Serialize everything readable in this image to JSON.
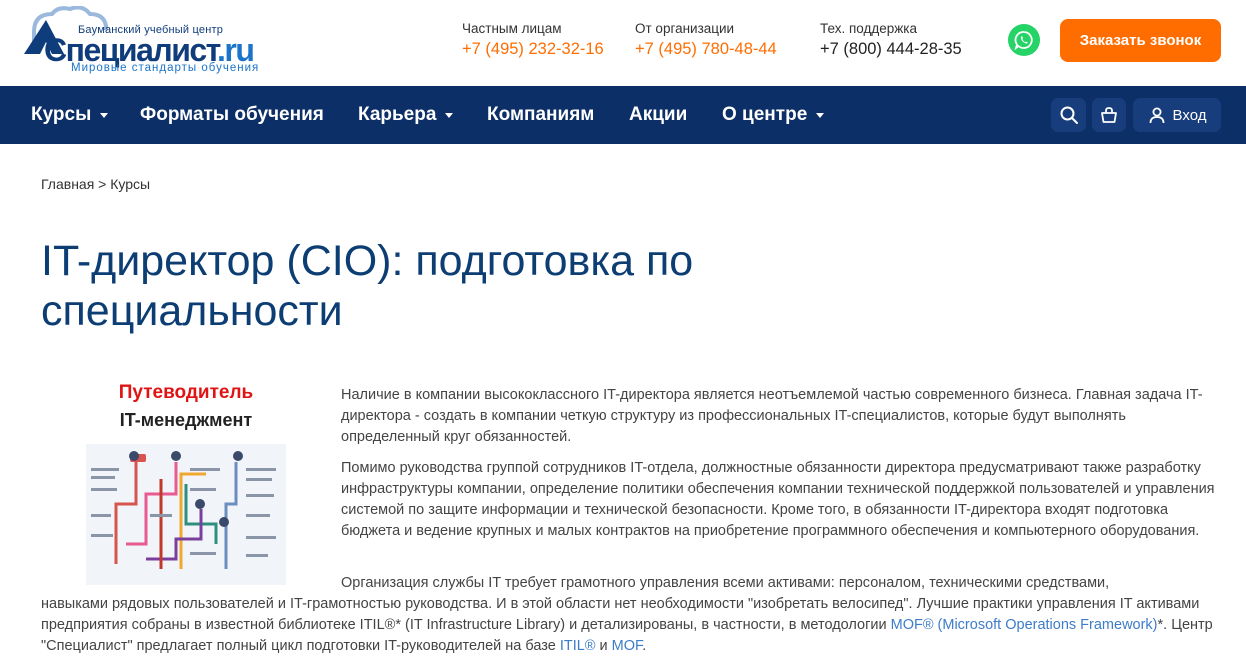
{
  "header": {
    "logo": {
      "tagline_top": "Бауманский учебный центр",
      "brand": "Специалист",
      "brand_suffix": ".ru",
      "motto": "Мировые стандарты обучения"
    },
    "contacts": [
      {
        "label": "Частным лицам",
        "phone": "+7 (495) 232-32-16"
      },
      {
        "label": "От организации",
        "phone": "+7 (495) 780-48-44"
      },
      {
        "label": "Тех. поддержка",
        "phone": "+7 (800) 444-28-35"
      }
    ],
    "callback_label": "Заказать звонок"
  },
  "nav": {
    "items": [
      {
        "label": "Курсы"
      },
      {
        "label": "Форматы обучения"
      },
      {
        "label": "Карьера"
      },
      {
        "label": "Компаниям"
      },
      {
        "label": "Акции"
      },
      {
        "label": "О центре"
      }
    ],
    "login_label": "Вход"
  },
  "breadcrumb": {
    "home": "Главная",
    "sep": " > ",
    "current": "Курсы"
  },
  "page": {
    "title": "IT-директор (CIO): подготовка по специальности",
    "guide_title": "Путеводитель",
    "guide_subtitle": "IT-менеджмент",
    "p1": "Наличие в компании высококлассного IT-директора является неотъемлемой частью современного бизнеса. Главная задача IT-директора - создать в компании четкую структуру из профессиональных IT-специалистов, которые будут выполнять определенный круг обязанностей.",
    "p2": "Помимо руководства группой сотрудников IT-отдела, должностные обязанности директора предусматривают также разработку инфраструктуры компании, определение политики обеспечения компании технической поддержкой пользователей и управления системой по защите информации и технической безопасности. Кроме того, в обязанности IT-директора входят подготовка бюджета и ведение крупных и малых контрактов на приобретение программного обеспечения и компьютерного оборудования.",
    "p3_first": "Организация службы IT требует грамотного управления всеми активами: персоналом, техническими средствами,",
    "p3_rest_a": "навыками рядовых пользователей и IT-грамотностью руководства. И в этой области нет необходимости \"изобретать велосипед\". Лучшие практики управления IT активами предприятия собраны в известной библиотеке ITIL®* (IT Infrastructure Library) и детализированы, в частности, в методологии ",
    "link_mof_full": "MOF® (Microsoft Operations Framework)",
    "p3_rest_b": "*. Центр \"Специалист\" предлагает полный цикл подготовки IT-руководителей на базе ",
    "link_itil": "ITIL®",
    "p3_and": " и ",
    "link_mof": "MOF",
    "p3_end": "."
  },
  "colors": {
    "accent_orange": "#ff6d00",
    "nav_blue": "#0c2f67",
    "title_blue": "#0c3d73",
    "link_blue": "#3d7cc9",
    "guide_red": "#e01414"
  }
}
